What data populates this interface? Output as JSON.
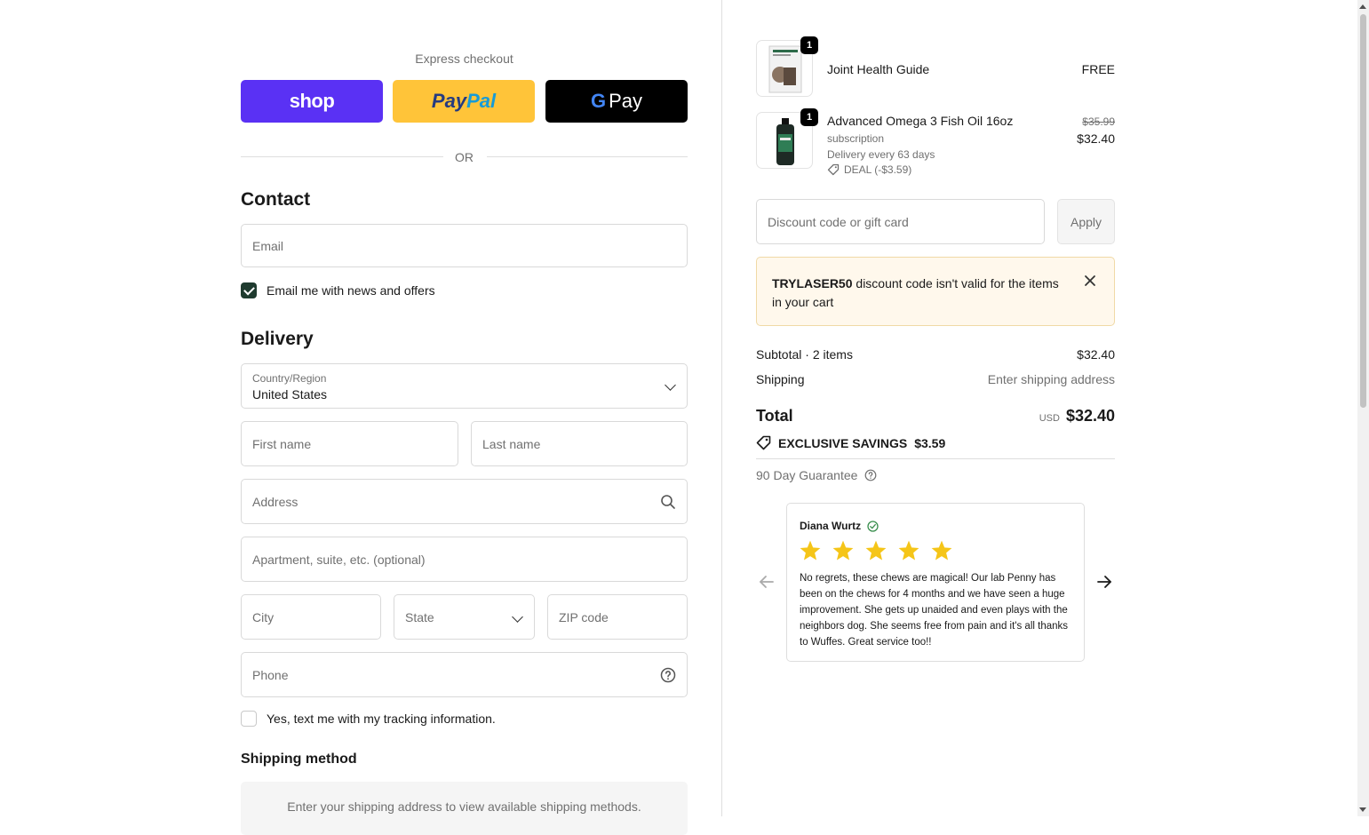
{
  "express": {
    "title": "Express checkout",
    "shop_label": "shop",
    "paypal_label_1": "Pay",
    "paypal_label_2": "Pal",
    "gpay_g": "G",
    "gpay_label": "Pay",
    "or_label": "OR"
  },
  "contact": {
    "title": "Contact",
    "email_placeholder": "Email",
    "newsletter_label": "Email me with news and offers",
    "newsletter_checked": true
  },
  "delivery": {
    "title": "Delivery",
    "country_label": "Country/Region",
    "country_value": "United States",
    "first_name_placeholder": "First name",
    "last_name_placeholder": "Last name",
    "address_placeholder": "Address",
    "apartment_placeholder": "Apartment, suite, etc. (optional)",
    "city_placeholder": "City",
    "state_placeholder": "State",
    "zip_placeholder": "ZIP code",
    "phone_placeholder": "Phone",
    "sms_label": "Yes, text me with my tracking information.",
    "sms_checked": false
  },
  "shipping_method": {
    "title": "Shipping method",
    "message": "Enter your shipping address to view available shipping methods."
  },
  "order": {
    "items": [
      {
        "name": "Joint Health Guide",
        "quantity": "1",
        "price": "FREE"
      },
      {
        "name": "Advanced Omega 3 Fish Oil 16oz",
        "quantity": "1",
        "subscription": "subscription",
        "delivery": "Delivery every 63 days",
        "deal": "DEAL (-$3.59)",
        "original_price": "$35.99",
        "price": "$32.40"
      }
    ],
    "discount_placeholder": "Discount code or gift card",
    "apply_label": "Apply",
    "alert_code": "TRYLASER50",
    "alert_message": " discount code isn't valid for the items in your cart",
    "subtotal_label": "Subtotal · 2 items",
    "subtotal_value": "$32.40",
    "shipping_label": "Shipping",
    "shipping_value": "Enter shipping address",
    "total_label": "Total",
    "total_currency": "USD",
    "total_value": "$32.40",
    "savings_label": "EXCLUSIVE SAVINGS",
    "savings_value": "$3.59",
    "guarantee_label": "90 Day Guarantee"
  },
  "review": {
    "name": "Diana Wurtz",
    "rating": 5,
    "text": "No regrets, these chews are magical! Our lab Penny has been on the chews for 4 months and we have seen a huge improvement. She gets up unaided and even plays with the neighbors dog. She seems free from pain and it's all thanks to Wuffes. Great service too!!"
  },
  "colors": {
    "shop": "#5a31f4",
    "paypal": "#ffc439",
    "checkbox": "#1f3b2f",
    "star": "#f5c518",
    "alert_bg": "#fff8ec"
  }
}
